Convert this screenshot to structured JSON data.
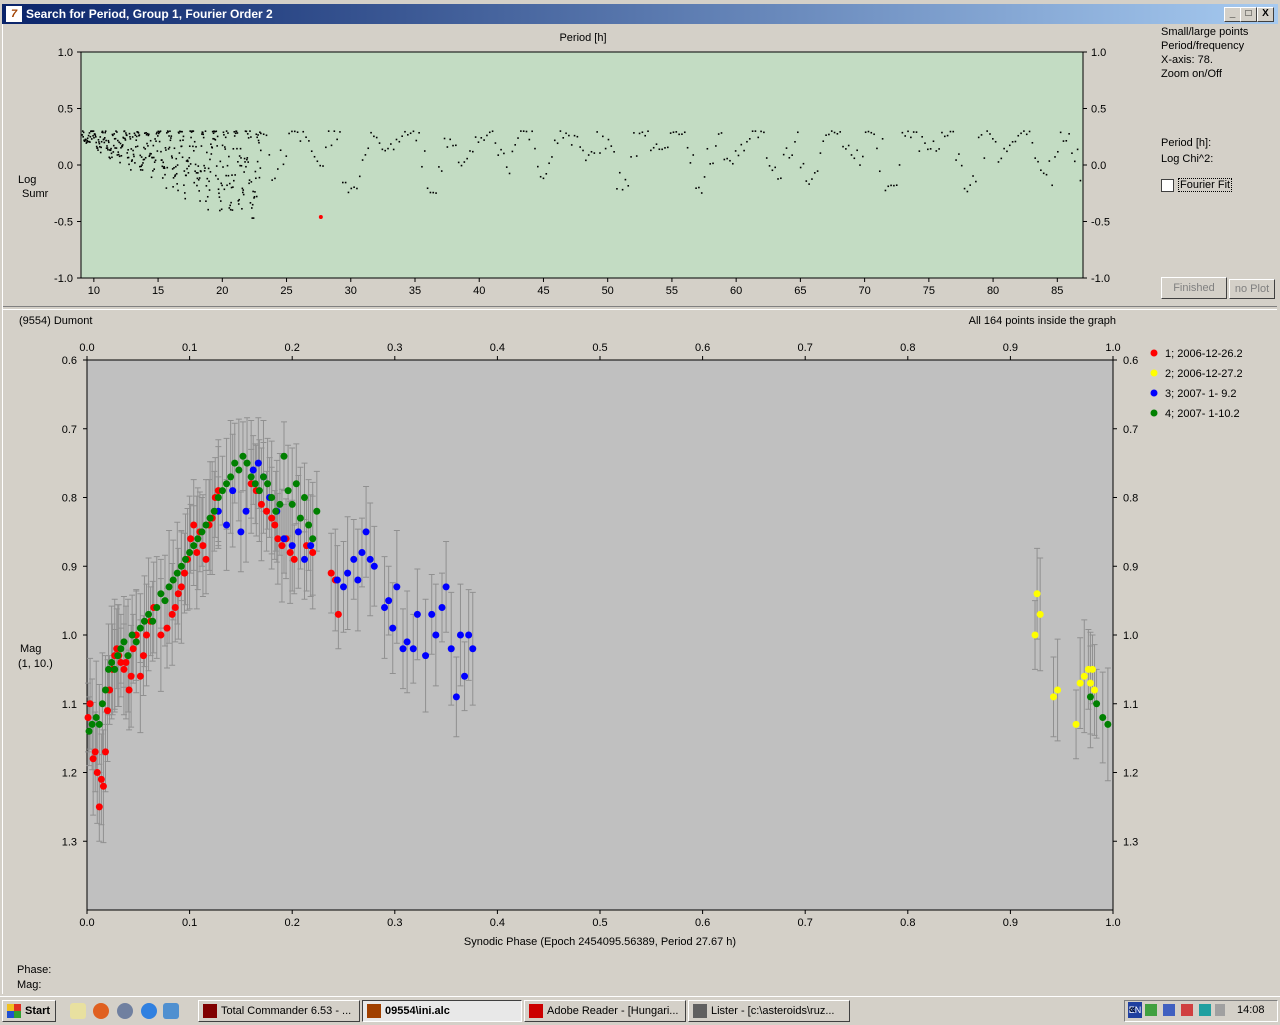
{
  "window": {
    "title": "Search for Period, Group 1, Fourier Order 2",
    "controls": {
      "minimize": "_",
      "maximize": "□",
      "close": "X"
    }
  },
  "periodogram": {
    "top_axis_label": "Period [h]",
    "ylabel_line1": "Log",
    "ylabel_line2": "Sumr",
    "x_ticks": [
      10,
      15,
      20,
      25,
      30,
      35,
      40,
      45,
      50,
      55,
      60,
      65,
      70,
      75,
      80,
      85
    ],
    "y_ticks": [
      "1.0",
      "0.5",
      "0.0",
      "-0.5",
      "-1.0"
    ],
    "xlim": [
      9,
      87
    ],
    "ylim": [
      -1.0,
      1.0
    ],
    "background": "#c3dcc3",
    "best_point": {
      "x": 27.67,
      "y": -0.46,
      "color": "#ff0000"
    }
  },
  "side_panel": {
    "info_lines": [
      "Small/large points",
      "Period/frequency",
      "X-axis: 78.",
      "Zoom on/Off"
    ],
    "period_label": "Period [h]:",
    "logchi_label": "Log Chi^2:",
    "fourier_fit_label": "Fourier Fit",
    "finished_button": "Finished",
    "no_plot_button": "no Plot"
  },
  "lightcurve": {
    "object_name": "(9554) Dumont",
    "points_info": "All 164 points inside the graph",
    "xlabel": "Synodic Phase (Epoch 2454095.56389, Period 27.67 h)",
    "ylabel_line1": "Mag",
    "ylabel_line2": "(1, 10.)",
    "x_ticks": [
      "0.0",
      "0.1",
      "0.2",
      "0.3",
      "0.4",
      "0.5",
      "0.6",
      "0.7",
      "0.8",
      "0.9",
      "1.0"
    ],
    "y_ticks": [
      "0.6",
      "0.7",
      "0.8",
      "0.9",
      "1.0",
      "1.1",
      "1.2",
      "1.3"
    ],
    "background": "#c0c0c0",
    "legend": [
      {
        "label": "1; 2006-12-26.2",
        "color": "#ff0000"
      },
      {
        "label": "2; 2006-12-27.2",
        "color": "#ffff00"
      },
      {
        "label": "3; 2007- 1- 9.2",
        "color": "#0000ff"
      },
      {
        "label": "4; 2007- 1-10.2",
        "color": "#008000"
      }
    ]
  },
  "status": {
    "phase_label": "Phase:",
    "mag_label": "Mag:"
  },
  "taskbar": {
    "start_label": "Start",
    "buttons": [
      {
        "label": "Total Commander 6.53 - ...",
        "icon_color": "#800000",
        "active": false
      },
      {
        "label": "09554\\ini.alc",
        "icon_color": "#a04000",
        "active": true
      },
      {
        "label": "Adobe Reader - [Hungari...",
        "icon_color": "#cc0000",
        "active": false
      },
      {
        "label": "Lister - [c:\\asteroids\\ruz...",
        "icon_color": "#606060",
        "active": false
      }
    ],
    "language": "EN",
    "clock": "14:08"
  },
  "chart_data": [
    {
      "type": "scatter",
      "title": "",
      "xlabel": "Period [h]",
      "ylabel": "Log Sumr",
      "xlim": [
        9,
        87
      ],
      "ylim": [
        -1.0,
        1.0
      ],
      "series": [
        {
          "x": [
            27.67
          ],
          "y": [
            -0.46
          ]
        }
      ]
    },
    {
      "type": "scatter",
      "title": "(9554) Dumont",
      "xlabel": "Synodic Phase (Epoch 2454095.56389, Period 27.67 h)",
      "ylabel": "Mag (1, 10.)",
      "xlim": [
        0.0,
        1.0
      ],
      "ylim": [
        1.4,
        0.6
      ],
      "series": [
        {
          "name": "1; 2006-12-26.2",
          "color": "#ff0000",
          "x": [
            0.001,
            0.003,
            0.006,
            0.008,
            0.01,
            0.012,
            0.014,
            0.016,
            0.018,
            0.02,
            0.022,
            0.025,
            0.027,
            0.029,
            0.031,
            0.033,
            0.036,
            0.038,
            0.041,
            0.043,
            0.045,
            0.048,
            0.052,
            0.055,
            0.058,
            0.062,
            0.065,
            0.072,
            0.078,
            0.083,
            0.086,
            0.089,
            0.092,
            0.095,
            0.098,
            0.101,
            0.104,
            0.107,
            0.11,
            0.113,
            0.116,
            0.119,
            0.122,
            0.125,
            0.128,
            0.16,
            0.165,
            0.17,
            0.175,
            0.18,
            0.183,
            0.186,
            0.19,
            0.194,
            0.198,
            0.202,
            0.214,
            0.22,
            0.238,
            0.242,
            0.245
          ],
          "y": [
            1.12,
            1.1,
            1.18,
            1.17,
            1.2,
            1.25,
            1.21,
            1.22,
            1.17,
            1.11,
            1.08,
            1.05,
            1.03,
            1.02,
            1.03,
            1.04,
            1.05,
            1.04,
            1.08,
            1.06,
            1.02,
            1.0,
            1.06,
            1.03,
            1.0,
            0.98,
            0.96,
            1.0,
            0.99,
            0.97,
            0.96,
            0.94,
            0.93,
            0.91,
            0.89,
            0.86,
            0.84,
            0.88,
            0.85,
            0.87,
            0.89,
            0.84,
            0.83,
            0.8,
            0.79,
            0.78,
            0.79,
            0.81,
            0.82,
            0.83,
            0.84,
            0.86,
            0.87,
            0.86,
            0.88,
            0.89,
            0.87,
            0.88,
            0.91,
            0.92,
            0.97
          ]
        },
        {
          "name": "2; 2006-12-27.2",
          "color": "#ffff00",
          "x": [
            0.924,
            0.926,
            0.929,
            0.942,
            0.946,
            0.964,
            0.968,
            0.972,
            0.976,
            0.978,
            0.98,
            0.982
          ],
          "y": [
            1.0,
            0.94,
            0.97,
            1.09,
            1.08,
            1.13,
            1.07,
            1.06,
            1.05,
            1.07,
            1.05,
            1.08
          ]
        },
        {
          "name": "3; 2007- 1- 9.2",
          "color": "#0000ff",
          "x": [
            0.128,
            0.136,
            0.142,
            0.15,
            0.155,
            0.162,
            0.167,
            0.172,
            0.178,
            0.185,
            0.192,
            0.2,
            0.206,
            0.212,
            0.218,
            0.244,
            0.25,
            0.254,
            0.26,
            0.264,
            0.268,
            0.272,
            0.276,
            0.28,
            0.29,
            0.294,
            0.298,
            0.302,
            0.308,
            0.312,
            0.318,
            0.322,
            0.33,
            0.336,
            0.34,
            0.346,
            0.35,
            0.355,
            0.36,
            0.364,
            0.368,
            0.372,
            0.376
          ],
          "y": [
            0.82,
            0.84,
            0.79,
            0.85,
            0.82,
            0.76,
            0.75,
            0.77,
            0.8,
            0.82,
            0.86,
            0.87,
            0.85,
            0.89,
            0.87,
            0.92,
            0.93,
            0.91,
            0.89,
            0.92,
            0.88,
            0.85,
            0.89,
            0.9,
            0.96,
            0.95,
            0.99,
            0.93,
            1.02,
            1.01,
            1.02,
            0.97,
            1.03,
            0.97,
            1.0,
            0.96,
            0.93,
            1.02,
            1.09,
            1.0,
            1.06,
            1.0,
            1.02
          ]
        },
        {
          "name": "4; 2007- 1-10.2",
          "color": "#008000",
          "x": [
            0.002,
            0.005,
            0.009,
            0.012,
            0.015,
            0.018,
            0.021,
            0.024,
            0.027,
            0.03,
            0.033,
            0.036,
            0.04,
            0.044,
            0.048,
            0.052,
            0.056,
            0.06,
            0.064,
            0.068,
            0.072,
            0.076,
            0.08,
            0.084,
            0.088,
            0.092,
            0.096,
            0.1,
            0.104,
            0.108,
            0.112,
            0.116,
            0.12,
            0.124,
            0.128,
            0.132,
            0.136,
            0.14,
            0.144,
            0.148,
            0.152,
            0.156,
            0.16,
            0.164,
            0.168,
            0.172,
            0.176,
            0.18,
            0.184,
            0.188,
            0.192,
            0.196,
            0.2,
            0.204,
            0.208,
            0.212,
            0.216,
            0.22,
            0.224,
            0.978,
            0.984,
            0.99,
            0.995
          ],
          "y": [
            1.14,
            1.13,
            1.12,
            1.13,
            1.1,
            1.08,
            1.05,
            1.04,
            1.05,
            1.03,
            1.02,
            1.01,
            1.03,
            1.0,
            1.01,
            0.99,
            0.98,
            0.97,
            0.98,
            0.96,
            0.94,
            0.95,
            0.93,
            0.92,
            0.91,
            0.9,
            0.89,
            0.88,
            0.87,
            0.86,
            0.85,
            0.84,
            0.83,
            0.82,
            0.8,
            0.79,
            0.78,
            0.77,
            0.75,
            0.76,
            0.74,
            0.75,
            0.77,
            0.78,
            0.79,
            0.77,
            0.78,
            0.8,
            0.82,
            0.81,
            0.74,
            0.79,
            0.81,
            0.78,
            0.83,
            0.8,
            0.84,
            0.86,
            0.82,
            1.09,
            1.1,
            1.12,
            1.13
          ]
        }
      ]
    }
  ]
}
